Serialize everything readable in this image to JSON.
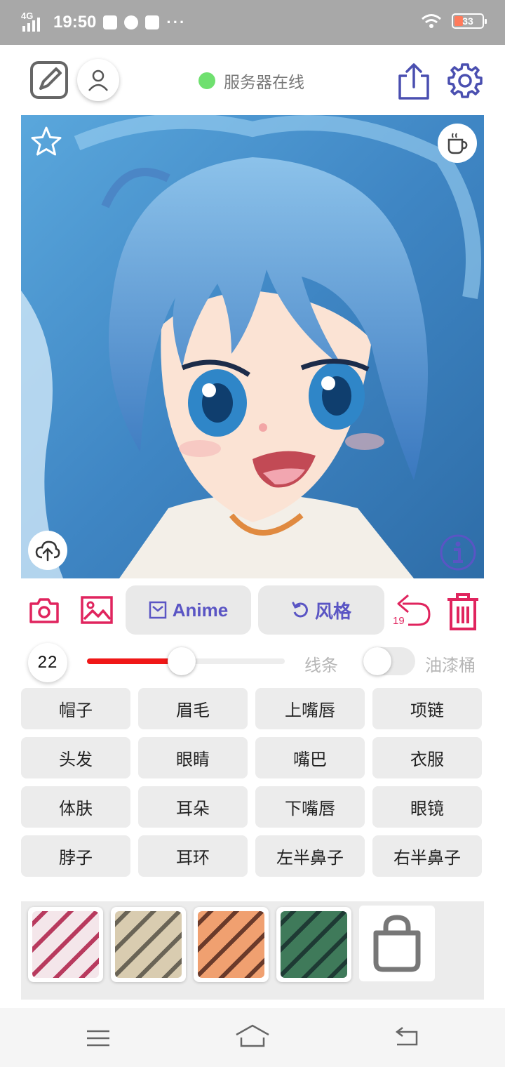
{
  "statusbar": {
    "network": "4G",
    "time": "19:50",
    "dots": "···",
    "battery": "33"
  },
  "header": {
    "server_status": "服务器在线",
    "status_color": "#6fe06f"
  },
  "tools": {
    "anime_label": "Anime",
    "style_label": "风格",
    "undo_count": "19"
  },
  "brush": {
    "size": "22",
    "slider_fraction": 0.48,
    "line_label": "线条",
    "bucket_label": "油漆桶",
    "bucket_enabled": false
  },
  "parts": [
    "帽子",
    "眉毛",
    "上嘴唇",
    "项链",
    "头发",
    "眼睛",
    "嘴巴",
    "衣服",
    "体肤",
    "耳朵",
    "下嘴唇",
    "眼镜",
    "脖子",
    "耳环",
    "左半鼻子",
    "右半鼻子"
  ],
  "styles": [
    {
      "name": "red-white-style",
      "colors": [
        "#f4e6ea",
        "#b83a5e"
      ]
    },
    {
      "name": "beige-gray-style",
      "colors": [
        "#d9ccb0",
        "#6a6456"
      ]
    },
    {
      "name": "orange-style",
      "colors": [
        "#f0a070",
        "#6a3a2a"
      ]
    },
    {
      "name": "green-style",
      "colors": [
        "#3f7a5a",
        "#1e3a34"
      ]
    }
  ],
  "colors": {
    "accent": "#e0245e",
    "purple": "#5a55c4",
    "slider": "#f01818"
  }
}
